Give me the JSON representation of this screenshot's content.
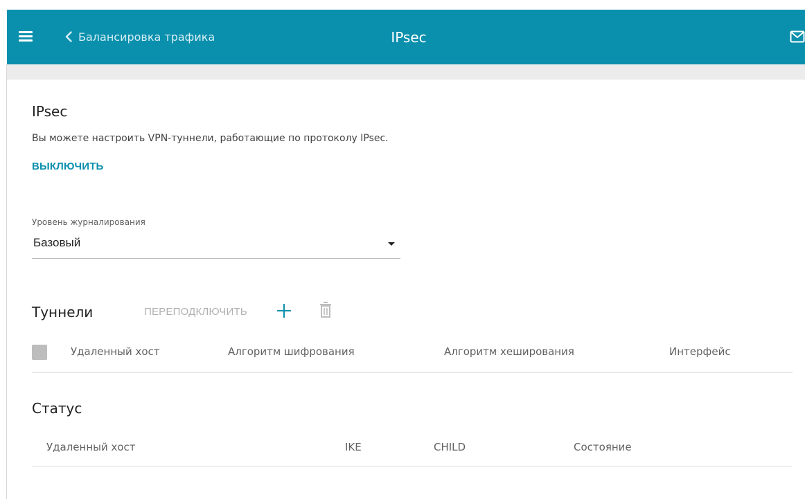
{
  "header": {
    "back_label": "Балансировка трафика",
    "title": "IPsec",
    "accent_color": "#0a90ad"
  },
  "icons": {
    "menu": "hamburger-icon",
    "back": "chevron-left-icon",
    "mail": "mail-icon",
    "add": "plus-icon",
    "delete": "trash-icon",
    "select": "caret-down-icon"
  },
  "ipsec": {
    "title": "IPsec",
    "description": "Вы можете настроить VPN-туннели, работающие по протоколу IPsec.",
    "toggle_label": "ВЫКЛЮЧИТЬ"
  },
  "logging": {
    "label": "Уровень журналирования",
    "value": "Базовый"
  },
  "tunnels": {
    "title": "Туннели",
    "reconnect_label": "ПЕРЕПОДКЛЮЧИТЬ",
    "columns": [
      "Удаленный хост",
      "Алгоритм шифрования",
      "Алгоритм хеширования",
      "Интерфейс"
    ]
  },
  "status": {
    "title": "Статус",
    "columns": [
      "Удаленный хост",
      "IKE",
      "CHILD",
      "Состояние"
    ]
  }
}
